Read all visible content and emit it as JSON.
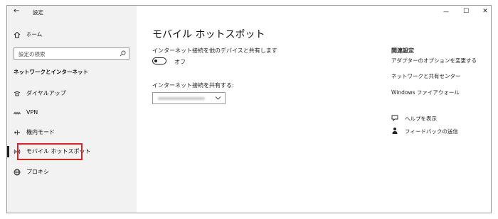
{
  "window": {
    "title": "設定",
    "controls": {
      "minimize": "—",
      "maximize": "☐",
      "close": "✕"
    }
  },
  "sidebar": {
    "home": "ホーム",
    "search_placeholder": "設定の検索",
    "section_title": "ネットワークとインターネット",
    "items": [
      {
        "label": "ダイヤルアップ",
        "icon": "dialup-icon"
      },
      {
        "label": "VPN",
        "icon": "vpn-icon"
      },
      {
        "label": "機内モード",
        "icon": "airplane-icon"
      },
      {
        "label": "モバイル ホットスポット",
        "icon": "hotspot-icon",
        "selected": true
      },
      {
        "label": "プロキシ",
        "icon": "globe-icon"
      }
    ]
  },
  "main": {
    "title": "モバイル ホットスポット",
    "share_label": "インターネット接続を他のデバイスと共有します",
    "toggle_state": "オフ",
    "share_from_label": "インターネット接続を共有する:"
  },
  "related": {
    "title": "関連設定",
    "links": [
      "アダプターのオプションを変更する",
      "ネットワークと共有センター",
      "Windows ファイアウォール"
    ],
    "help": "ヘルプを表示",
    "feedback": "フィードバックの送信"
  },
  "colors": {
    "highlight_border": "#d0262b",
    "sidebar_bg": "#f2f2f2"
  }
}
